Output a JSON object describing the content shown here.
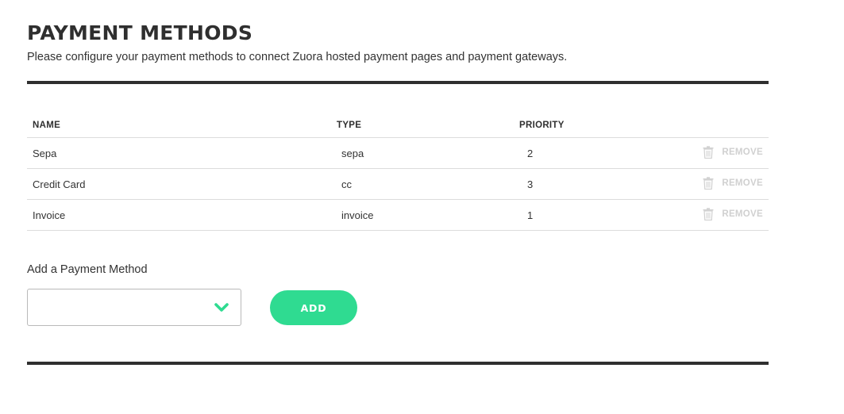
{
  "header": {
    "title": "PAYMENT METHODS",
    "subtitle": "Please configure your payment methods to connect Zuora hosted payment pages and payment gateways."
  },
  "table": {
    "columns": {
      "name": "NAME",
      "type": "TYPE",
      "priority": "PRIORITY"
    },
    "rows": [
      {
        "name": "Sepa",
        "type": "sepa",
        "priority": "2",
        "action": "REMOVE"
      },
      {
        "name": "Credit Card",
        "type": "cc",
        "priority": "3",
        "action": "REMOVE"
      },
      {
        "name": "Invoice",
        "type": "invoice",
        "priority": "1",
        "action": "REMOVE"
      }
    ]
  },
  "add_form": {
    "label": "Add a Payment Method",
    "select_value": "",
    "button_label": "ADD"
  },
  "icons": {
    "remove": "trash-icon",
    "dropdown": "chevron-down-icon"
  },
  "colors": {
    "accent": "#2fdb91",
    "text": "#333333",
    "muted": "#d0d0d0",
    "rule": "#2f2f2f"
  }
}
